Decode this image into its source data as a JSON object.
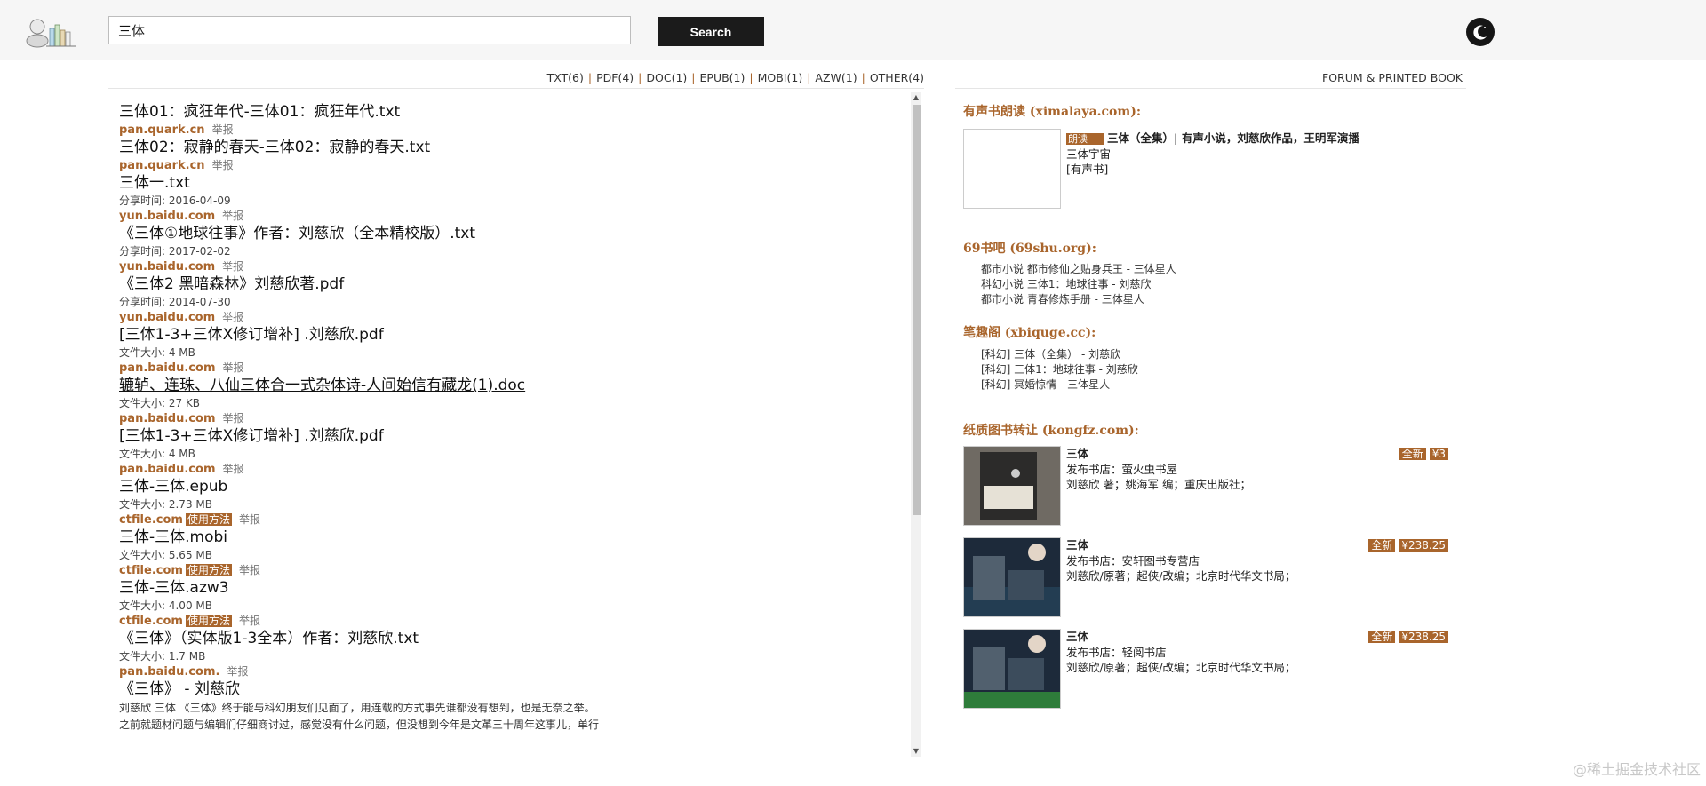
{
  "header": {
    "search_value": "三体",
    "search_button": "Search",
    "logo_icon": "books-logo-icon",
    "theme_icon": "moon-icon"
  },
  "filters": [
    {
      "label": "TXT(6)"
    },
    {
      "label": "PDF(4)"
    },
    {
      "label": "DOC(1)"
    },
    {
      "label": "EPUB(1)"
    },
    {
      "label": "MOBI(1)"
    },
    {
      "label": "AZW(1)"
    },
    {
      "label": "OTHER(4)"
    }
  ],
  "forum_link": "FORUM & PRINTED BOOK",
  "report_label": "举报",
  "howto_label": "使用方法",
  "results": [
    {
      "title": "三体01：疯狂年代-三体01：疯狂年代.txt",
      "meta": "",
      "domain": "pan.quark.cn",
      "howto": false
    },
    {
      "title": "三体02：寂静的春天-三体02：寂静的春天.txt",
      "meta": "",
      "domain": "pan.quark.cn",
      "howto": false
    },
    {
      "title": "三体一.txt",
      "meta": "分享时间: 2016-04-09",
      "domain": "yun.baidu.com",
      "howto": false
    },
    {
      "title": "《三体①地球往事》作者：刘慈欣（全本精校版）.txt",
      "meta": "分享时间: 2017-02-02",
      "domain": "yun.baidu.com",
      "howto": false
    },
    {
      "title": "《三体2 黑暗森林》刘慈欣著.pdf",
      "meta": "分享时间: 2014-07-30",
      "domain": "yun.baidu.com",
      "howto": false
    },
    {
      "title": "[三体1-3+三体X修订增补] .刘慈欣.pdf",
      "meta": "文件大小: 4 MB",
      "domain": "pan.baidu.com",
      "howto": false
    },
    {
      "title": "辘轳、连珠、八仙三体合一式杂体诗-人间始信有藏龙(1).doc",
      "meta": "文件大小: 27 KB",
      "domain": "pan.baidu.com",
      "howto": false,
      "underline": true
    },
    {
      "title": "[三体1-3+三体X修订增补] .刘慈欣.pdf",
      "meta": "文件大小: 4 MB",
      "domain": "pan.baidu.com",
      "howto": false
    },
    {
      "title": "三体-三体.epub",
      "meta": "文件大小: 2.73 MB",
      "domain": "ctfile.com",
      "howto": true
    },
    {
      "title": "三体-三体.mobi",
      "meta": "文件大小: 5.65 MB",
      "domain": "ctfile.com",
      "howto": true
    },
    {
      "title": "三体-三体.azw3",
      "meta": "文件大小: 4.00 MB",
      "domain": "ctfile.com",
      "howto": true
    },
    {
      "title": "《三体》（实体版1-3全本）作者：刘慈欣.txt",
      "meta": "文件大小: 1.7 MB",
      "domain": "pan.baidu.com.",
      "howto": false
    }
  ],
  "last_result": {
    "title": "《三体》 - 刘慈欣",
    "desc_line1": "刘慈欣 三体 《三体》终于能与科幻朋友们见面了，用连载的方式事先谁都没有想到，也是无奈之举。",
    "desc_line2": "之前就题材问题与编辑们仔细商讨过，感觉没有什么问题，但没想到今年是文革三十周年这事儿，单行"
  },
  "audio": {
    "heading": "有声书朗读 (ximalaya.com):",
    "tag": "朗读",
    "title": "三体（全集）| 有声小说，刘慈欣作品，王明军演播",
    "author": "三体宇宙",
    "type": "[有声书]"
  },
  "shu69": {
    "heading": "69书吧 (69shu.org):",
    "items": [
      "都市小说 都市修仙之贴身兵王 - 三体星人",
      "科幻小说 三体1：地球往事 - 刘慈欣",
      "都市小说 青春修炼手册 - 三体星人"
    ]
  },
  "xbiquge": {
    "heading": "笔趣阁 (xbiquge.cc):",
    "items": [
      "[科幻] 三体（全集） - 刘慈欣",
      "[科幻] 三体1：地球往事 - 刘慈欣",
      "[科幻] 冥婚惊情 - 三体星人"
    ]
  },
  "kongfz": {
    "heading": "纸质图书转让 (kongfz.com):",
    "books": [
      {
        "title": "三体",
        "shop": "发布书店：萤火虫书屋",
        "info": "刘慈欣 著；姚海军 编；重庆出版社；",
        "condition": "全新",
        "price": "¥3"
      },
      {
        "title": "三体",
        "shop": "发布书店：安轩图书专营店",
        "info": "刘慈欣/原著；超侠/改编；北京时代华文书局；",
        "condition": "全新",
        "price": "¥238.25"
      },
      {
        "title": "三体",
        "shop": "发布书店：轻阅书店",
        "info": "刘慈欣/原著；超侠/改编；北京时代华文书局；",
        "condition": "全新",
        "price": "¥238.25"
      }
    ]
  },
  "watermark": "@稀土掘金技术社区",
  "colors": {
    "accent": "#a9652c",
    "button": "#1b1b1b"
  }
}
